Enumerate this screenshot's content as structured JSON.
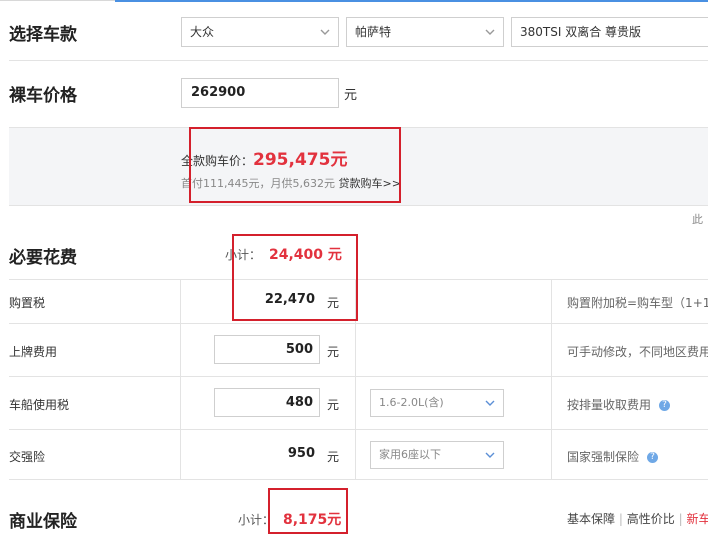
{
  "select_model": {
    "title": "选择车款",
    "brand": "大众",
    "series": "帕萨特",
    "trim": "380TSI 双离合 尊贵版"
  },
  "bare_price": {
    "title": "裸车价格",
    "value": "262900",
    "unit": "元"
  },
  "summary": {
    "full_label": "全款购车价：",
    "full_price": "295,475元",
    "loan_text": "首付111,445元，月供5,632元",
    "loan_link": "贷款购车>>",
    "right_cut": "此"
  },
  "required": {
    "title": "必要花费",
    "subtotal_label": "小计：",
    "subtotal_value": "24,400 元",
    "rows": [
      {
        "label": "购置税",
        "value": "22,470",
        "unit": "元",
        "note": "购置附加税=购车型（1+1"
      },
      {
        "label": "上牌费用",
        "value": "500",
        "unit": "元",
        "note": "可手动修改，不同地区费用"
      },
      {
        "label": "车船使用税",
        "value": "480",
        "unit": "元",
        "option": "1.6-2.0L(含)",
        "note": "按排量收取费用"
      },
      {
        "label": "交强险",
        "value": "950",
        "unit": "元",
        "option": "家用6座以下",
        "note": "国家强制保险"
      }
    ]
  },
  "commercial": {
    "title": "商业保险",
    "subtotal_label": "小计：",
    "subtotal_value": "8,175元",
    "plans": [
      "基本保障",
      "高性价比",
      "新车"
    ],
    "separator": "|"
  },
  "colors": {
    "accent_red": "#e2323e",
    "highlight_box": "#d4202c",
    "help_icon": "#6fa8e6"
  }
}
